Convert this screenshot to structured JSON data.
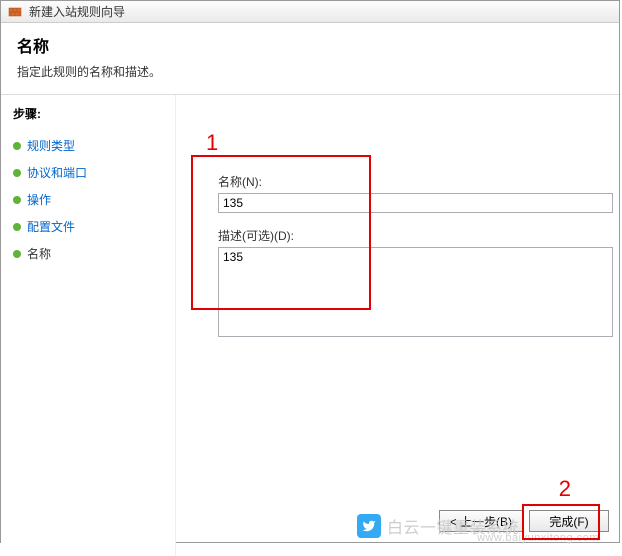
{
  "window": {
    "title": "新建入站规则向导"
  },
  "header": {
    "title": "名称",
    "description": "指定此规则的名称和描述。"
  },
  "sidebar": {
    "heading": "步骤:",
    "steps": [
      {
        "label": "规则类型",
        "state": "link"
      },
      {
        "label": "协议和端口",
        "state": "link"
      },
      {
        "label": "操作",
        "state": "link"
      },
      {
        "label": "配置文件",
        "state": "link"
      },
      {
        "label": "名称",
        "state": "current"
      }
    ]
  },
  "form": {
    "name_label": "名称(N):",
    "name_value": "135",
    "desc_label": "描述(可选)(D):",
    "desc_value": "135"
  },
  "buttons": {
    "back": "< 上一步(B)",
    "finish": "完成(F)"
  },
  "annotations": {
    "marker1": "1",
    "marker2": "2"
  },
  "watermark": {
    "text": "白云一键重装系统",
    "url": "www.baiyunxitong.com"
  }
}
